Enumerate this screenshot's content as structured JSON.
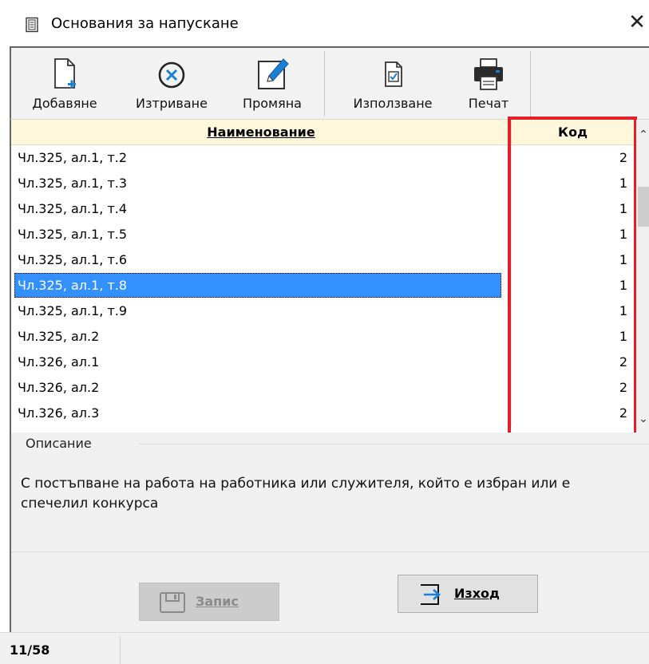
{
  "window": {
    "title": "Основания за напускане",
    "close_glyph": "✕",
    "title_icon": "document-list-icon"
  },
  "toolbar": {
    "buttons": [
      {
        "label": "Добавяне",
        "icon": "new-document-icon"
      },
      {
        "label": "Изтриване",
        "icon": "delete-circle-icon"
      },
      {
        "label": "Промяна",
        "icon": "edit-pencil-icon"
      },
      {
        "label": "Използване",
        "icon": "use-document-icon"
      },
      {
        "label": "Печат",
        "icon": "printer-icon"
      }
    ]
  },
  "grid": {
    "columns": {
      "name": "Наименование",
      "code": "Код"
    },
    "selected_index": 5,
    "rows": [
      {
        "name": "Чл.325, ал.1, т.2",
        "code": "2"
      },
      {
        "name": "Чл.325, ал.1, т.3",
        "code": "1"
      },
      {
        "name": "Чл.325, ал.1, т.4",
        "code": "1"
      },
      {
        "name": "Чл.325, ал.1, т.5",
        "code": "1"
      },
      {
        "name": "Чл.325, ал.1, т.6",
        "code": "1"
      },
      {
        "name": "Чл.325, ал.1, т.8",
        "code": "1"
      },
      {
        "name": "Чл.325, ал.1, т.9",
        "code": "1"
      },
      {
        "name": "Чл.325, ал.2",
        "code": "1"
      },
      {
        "name": "Чл.326, ал.1",
        "code": "2"
      },
      {
        "name": "Чл.326, ал.2",
        "code": "2"
      },
      {
        "name": "Чл.326, ал.3",
        "code": "2"
      }
    ],
    "highlight_color": "#e3202a",
    "selection_color": "#3390ff"
  },
  "description": {
    "legend": "Описание",
    "text": "С постъпване на работа на работника или служителя, който е избран или е спечелил конкурса"
  },
  "footer": {
    "save_label": "Запис",
    "save_enabled": false,
    "exit_label": "Изход"
  },
  "status": {
    "position": "11/58"
  }
}
